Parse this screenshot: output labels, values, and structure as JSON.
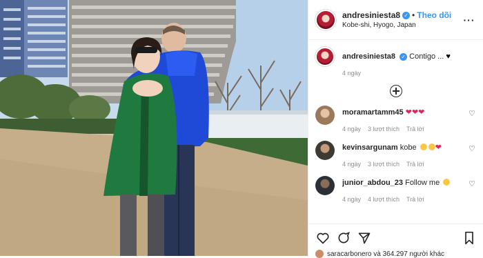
{
  "post": {
    "author": {
      "username": "andresiniesta8",
      "verified": true,
      "follow_label": "Theo dõi",
      "separator": "•",
      "location": "Kobe-shi, Hyogo, Japan",
      "avatar_color": "#b31e34"
    },
    "more_options_icon": "ellipsis-icon",
    "caption": {
      "username": "andresiniesta8",
      "text": "Contigo ...",
      "emoji": "black-heart",
      "time": "4 ngày"
    },
    "load_more_icon": "plus-circle-icon",
    "comments": [
      {
        "username": "moramartamm45",
        "text": "",
        "emojis": [
          "red-heart",
          "red-heart",
          "red-heart"
        ],
        "time": "4 ngày",
        "likes": "3 lượt thích",
        "reply": "Trả lời",
        "avatar_color": "#9b7a5c"
      },
      {
        "username": "kevinsargunam",
        "text": "kobe",
        "emojis": [
          "grinning-face",
          "grinning-face",
          "red-heart"
        ],
        "time": "4 ngày",
        "likes": "3 lượt thích",
        "reply": "Trả lời",
        "avatar_color": "#3d3a34"
      },
      {
        "username": "junior_abdou_23",
        "text": "Follow me",
        "emojis": [
          "crying-face"
        ],
        "time": "4 ngày",
        "likes": "4 lượt thích",
        "reply": "Trả lời",
        "avatar_color": "#2b2f36"
      }
    ],
    "actions": {
      "like_icon": "heart-icon",
      "comment_icon": "comment-icon",
      "share_icon": "send-icon",
      "save_icon": "bookmark-icon"
    },
    "liked_by": {
      "text": "saracarbonero và 364.297 người khác"
    },
    "colors": {
      "link_blue": "#3897f0",
      "meta_gray": "#8e8e8e",
      "heart_red": "#e0245e",
      "border": "#efefef"
    }
  }
}
